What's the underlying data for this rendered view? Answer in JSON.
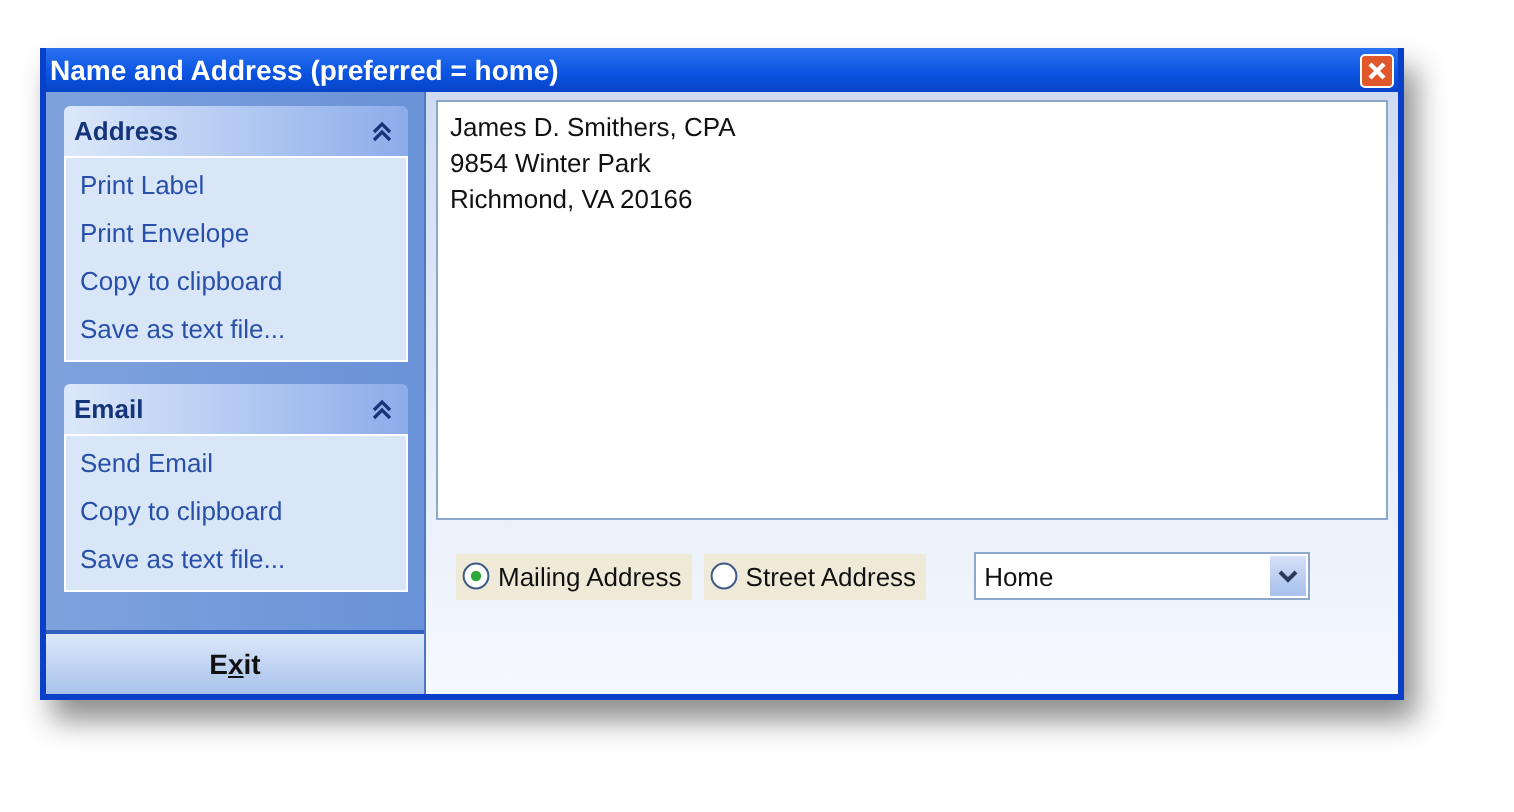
{
  "window": {
    "title": "Name and Address (preferred = home)"
  },
  "sidebar": {
    "groups": [
      {
        "title": "Address",
        "expanded": true,
        "items": [
          "Print Label",
          "Print Envelope",
          "Copy to clipboard",
          "Save as text file..."
        ]
      },
      {
        "title": "Email",
        "expanded": true,
        "items": [
          "Send Email",
          "Copy to clipboard",
          "Save as text file..."
        ]
      }
    ],
    "exit_button": {
      "label_before": "E",
      "access_key": "x",
      "label_after": "it"
    }
  },
  "address_box": {
    "lines": [
      "James D. Smithers, CPA",
      "9854 Winter Park",
      "Richmond, VA 20166"
    ]
  },
  "address_types": [
    {
      "label": "Mailing Address",
      "selected": true
    },
    {
      "label": "Street Address",
      "selected": false
    }
  ],
  "location_select": {
    "value": "Home"
  }
}
